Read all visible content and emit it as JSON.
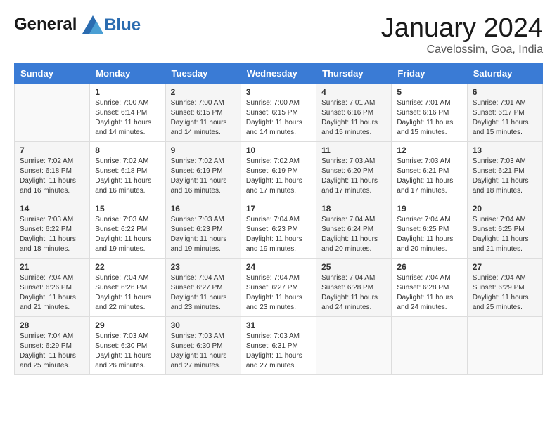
{
  "logo": {
    "text_general": "General",
    "text_blue": "Blue"
  },
  "header": {
    "month": "January 2024",
    "location": "Cavelossim, Goa, India"
  },
  "days_of_week": [
    "Sunday",
    "Monday",
    "Tuesday",
    "Wednesday",
    "Thursday",
    "Friday",
    "Saturday"
  ],
  "weeks": [
    [
      {
        "day": "",
        "sunrise": "",
        "sunset": "",
        "daylight": ""
      },
      {
        "day": "1",
        "sunrise": "Sunrise: 7:00 AM",
        "sunset": "Sunset: 6:14 PM",
        "daylight": "Daylight: 11 hours and 14 minutes."
      },
      {
        "day": "2",
        "sunrise": "Sunrise: 7:00 AM",
        "sunset": "Sunset: 6:15 PM",
        "daylight": "Daylight: 11 hours and 14 minutes."
      },
      {
        "day": "3",
        "sunrise": "Sunrise: 7:00 AM",
        "sunset": "Sunset: 6:15 PM",
        "daylight": "Daylight: 11 hours and 14 minutes."
      },
      {
        "day": "4",
        "sunrise": "Sunrise: 7:01 AM",
        "sunset": "Sunset: 6:16 PM",
        "daylight": "Daylight: 11 hours and 15 minutes."
      },
      {
        "day": "5",
        "sunrise": "Sunrise: 7:01 AM",
        "sunset": "Sunset: 6:16 PM",
        "daylight": "Daylight: 11 hours and 15 minutes."
      },
      {
        "day": "6",
        "sunrise": "Sunrise: 7:01 AM",
        "sunset": "Sunset: 6:17 PM",
        "daylight": "Daylight: 11 hours and 15 minutes."
      }
    ],
    [
      {
        "day": "7",
        "sunrise": "Sunrise: 7:02 AM",
        "sunset": "Sunset: 6:18 PM",
        "daylight": "Daylight: 11 hours and 16 minutes."
      },
      {
        "day": "8",
        "sunrise": "Sunrise: 7:02 AM",
        "sunset": "Sunset: 6:18 PM",
        "daylight": "Daylight: 11 hours and 16 minutes."
      },
      {
        "day": "9",
        "sunrise": "Sunrise: 7:02 AM",
        "sunset": "Sunset: 6:19 PM",
        "daylight": "Daylight: 11 hours and 16 minutes."
      },
      {
        "day": "10",
        "sunrise": "Sunrise: 7:02 AM",
        "sunset": "Sunset: 6:19 PM",
        "daylight": "Daylight: 11 hours and 17 minutes."
      },
      {
        "day": "11",
        "sunrise": "Sunrise: 7:03 AM",
        "sunset": "Sunset: 6:20 PM",
        "daylight": "Daylight: 11 hours and 17 minutes."
      },
      {
        "day": "12",
        "sunrise": "Sunrise: 7:03 AM",
        "sunset": "Sunset: 6:21 PM",
        "daylight": "Daylight: 11 hours and 17 minutes."
      },
      {
        "day": "13",
        "sunrise": "Sunrise: 7:03 AM",
        "sunset": "Sunset: 6:21 PM",
        "daylight": "Daylight: 11 hours and 18 minutes."
      }
    ],
    [
      {
        "day": "14",
        "sunrise": "Sunrise: 7:03 AM",
        "sunset": "Sunset: 6:22 PM",
        "daylight": "Daylight: 11 hours and 18 minutes."
      },
      {
        "day": "15",
        "sunrise": "Sunrise: 7:03 AM",
        "sunset": "Sunset: 6:22 PM",
        "daylight": "Daylight: 11 hours and 19 minutes."
      },
      {
        "day": "16",
        "sunrise": "Sunrise: 7:03 AM",
        "sunset": "Sunset: 6:23 PM",
        "daylight": "Daylight: 11 hours and 19 minutes."
      },
      {
        "day": "17",
        "sunrise": "Sunrise: 7:04 AM",
        "sunset": "Sunset: 6:23 PM",
        "daylight": "Daylight: 11 hours and 19 minutes."
      },
      {
        "day": "18",
        "sunrise": "Sunrise: 7:04 AM",
        "sunset": "Sunset: 6:24 PM",
        "daylight": "Daylight: 11 hours and 20 minutes."
      },
      {
        "day": "19",
        "sunrise": "Sunrise: 7:04 AM",
        "sunset": "Sunset: 6:25 PM",
        "daylight": "Daylight: 11 hours and 20 minutes."
      },
      {
        "day": "20",
        "sunrise": "Sunrise: 7:04 AM",
        "sunset": "Sunset: 6:25 PM",
        "daylight": "Daylight: 11 hours and 21 minutes."
      }
    ],
    [
      {
        "day": "21",
        "sunrise": "Sunrise: 7:04 AM",
        "sunset": "Sunset: 6:26 PM",
        "daylight": "Daylight: 11 hours and 21 minutes."
      },
      {
        "day": "22",
        "sunrise": "Sunrise: 7:04 AM",
        "sunset": "Sunset: 6:26 PM",
        "daylight": "Daylight: 11 hours and 22 minutes."
      },
      {
        "day": "23",
        "sunrise": "Sunrise: 7:04 AM",
        "sunset": "Sunset: 6:27 PM",
        "daylight": "Daylight: 11 hours and 23 minutes."
      },
      {
        "day": "24",
        "sunrise": "Sunrise: 7:04 AM",
        "sunset": "Sunset: 6:27 PM",
        "daylight": "Daylight: 11 hours and 23 minutes."
      },
      {
        "day": "25",
        "sunrise": "Sunrise: 7:04 AM",
        "sunset": "Sunset: 6:28 PM",
        "daylight": "Daylight: 11 hours and 24 minutes."
      },
      {
        "day": "26",
        "sunrise": "Sunrise: 7:04 AM",
        "sunset": "Sunset: 6:28 PM",
        "daylight": "Daylight: 11 hours and 24 minutes."
      },
      {
        "day": "27",
        "sunrise": "Sunrise: 7:04 AM",
        "sunset": "Sunset: 6:29 PM",
        "daylight": "Daylight: 11 hours and 25 minutes."
      }
    ],
    [
      {
        "day": "28",
        "sunrise": "Sunrise: 7:04 AM",
        "sunset": "Sunset: 6:29 PM",
        "daylight": "Daylight: 11 hours and 25 minutes."
      },
      {
        "day": "29",
        "sunrise": "Sunrise: 7:03 AM",
        "sunset": "Sunset: 6:30 PM",
        "daylight": "Daylight: 11 hours and 26 minutes."
      },
      {
        "day": "30",
        "sunrise": "Sunrise: 7:03 AM",
        "sunset": "Sunset: 6:30 PM",
        "daylight": "Daylight: 11 hours and 27 minutes."
      },
      {
        "day": "31",
        "sunrise": "Sunrise: 7:03 AM",
        "sunset": "Sunset: 6:31 PM",
        "daylight": "Daylight: 11 hours and 27 minutes."
      },
      {
        "day": "",
        "sunrise": "",
        "sunset": "",
        "daylight": ""
      },
      {
        "day": "",
        "sunrise": "",
        "sunset": "",
        "daylight": ""
      },
      {
        "day": "",
        "sunrise": "",
        "sunset": "",
        "daylight": ""
      }
    ]
  ]
}
